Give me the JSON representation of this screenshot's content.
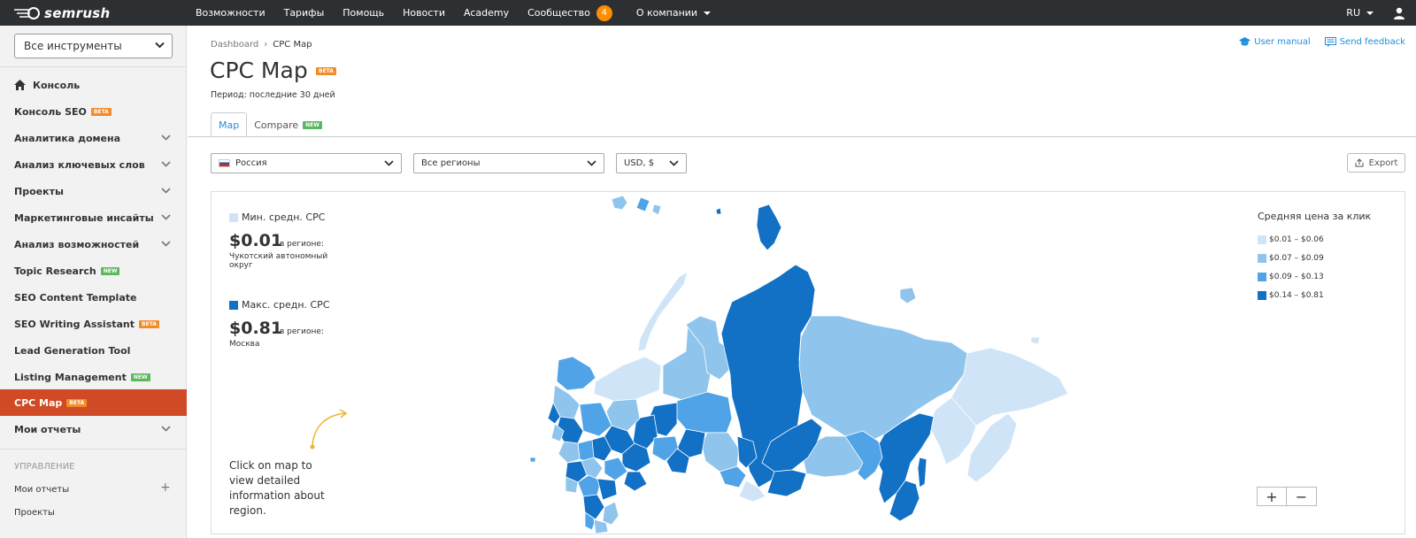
{
  "topbar": {
    "logo_text": "semrush",
    "nav": [
      {
        "label": "Возможности"
      },
      {
        "label": "Тарифы"
      },
      {
        "label": "Помощь"
      },
      {
        "label": "Новости"
      },
      {
        "label": "Academy"
      },
      {
        "label": "Сообщество",
        "badge": "4"
      },
      {
        "label": "О компании"
      }
    ],
    "lang": "RU"
  },
  "sidebar": {
    "tools_select": "Все инструменты",
    "items": [
      {
        "label": "Консоль",
        "icon": "home-icon"
      },
      {
        "label": "Консоль SEO",
        "tag": "BETA"
      },
      {
        "label": "Аналитика домена",
        "chevron": true
      },
      {
        "label": "Анализ ключевых слов",
        "chevron": true
      },
      {
        "label": "Проекты",
        "chevron": true
      },
      {
        "label": "Маркетинговые инсайты",
        "chevron": true
      },
      {
        "label": "Анализ возможностей",
        "chevron": true
      },
      {
        "label": "Topic Research",
        "tag": "NEW"
      },
      {
        "label": "SEO Content Template"
      },
      {
        "label": "SEO Writing Assistant",
        "tag": "BETA"
      },
      {
        "label": "Lead Generation Tool"
      },
      {
        "label": "Listing Management",
        "tag": "NEW"
      },
      {
        "label": "CPC Map",
        "tag": "BETA",
        "active": true
      },
      {
        "label": "Мои отчеты",
        "chevron": true
      }
    ],
    "section_title": "УПРАВЛЕНИЕ",
    "sub_items": [
      {
        "label": "Мои отчеты"
      },
      {
        "label": "Проекты"
      }
    ]
  },
  "main": {
    "breadcrumb": {
      "root": "Dashboard",
      "current": "CPC Map"
    },
    "user_manual": "User manual",
    "send_feedback": "Send feedback",
    "title": "CPC Map",
    "title_tag": "BETA",
    "period": "Период: последние 30 дней",
    "tabs": [
      {
        "label": "Map",
        "active": true
      },
      {
        "label": "Compare",
        "tag": "NEW"
      }
    ],
    "country_select": "Россия",
    "region_select": "Все регионы",
    "currency_select": "USD, $",
    "export_label": "Export",
    "min_stat": {
      "heading": "Мин. средн. CPC",
      "value": "$0.01",
      "in_region": "в регионе:",
      "region": "Чукотский автономный округ"
    },
    "max_stat": {
      "heading": "Макс. средн. CPC",
      "value": "$0.81",
      "in_region": "в регионе:",
      "region": "Москва"
    },
    "hint": "Click on map to view detailed information about region.",
    "legend": {
      "title": "Средняя цена за клик",
      "ranges": [
        {
          "label": "$0.01 – $0.06",
          "color": "#cfe5f7"
        },
        {
          "label": "$0.07 – $0.09",
          "color": "#8fc4ec"
        },
        {
          "label": "$0.09 – $0.13",
          "color": "#4fa3e6"
        },
        {
          "label": "$0.14 – $0.81",
          "color": "#1270c5"
        }
      ]
    },
    "zoom_in": "+",
    "zoom_out": "−"
  }
}
